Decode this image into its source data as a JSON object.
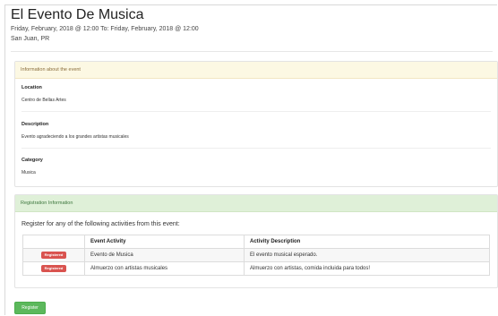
{
  "event": {
    "title": "El Evento De Musica",
    "date_range": "Friday, February, 2018 @ 12:00 To: Friday, February, 2018 @ 12:00",
    "place": "San Juan, PR"
  },
  "info_panel": {
    "heading": "Information about the event",
    "location_label": "Location",
    "location_value": "Centro de Bellas Artes",
    "description_label": "Description",
    "description_value": "Evento agradeciendo a los grandes artistas musicales",
    "category_label": "Category",
    "category_value": "Musica"
  },
  "registration_panel": {
    "heading": "Registration Information",
    "intro": "Register for any of the following activities from this event:",
    "columns": [
      "",
      "Event Activity",
      "Activity Description"
    ],
    "rows": [
      {
        "status": "Registered",
        "activity": "Evento de Musica",
        "description": "El evento musical esperado."
      },
      {
        "status": "Registered",
        "activity": "Almuerzo con artistas musicales",
        "description": "Almuerzo con artistas, comida incluida para todos!"
      }
    ]
  },
  "register_button": "Register",
  "colors": {
    "info_head": "#fcf8e3",
    "reg_head": "#dff0d8",
    "badge": "#d9534f",
    "button": "#5cb85c"
  }
}
